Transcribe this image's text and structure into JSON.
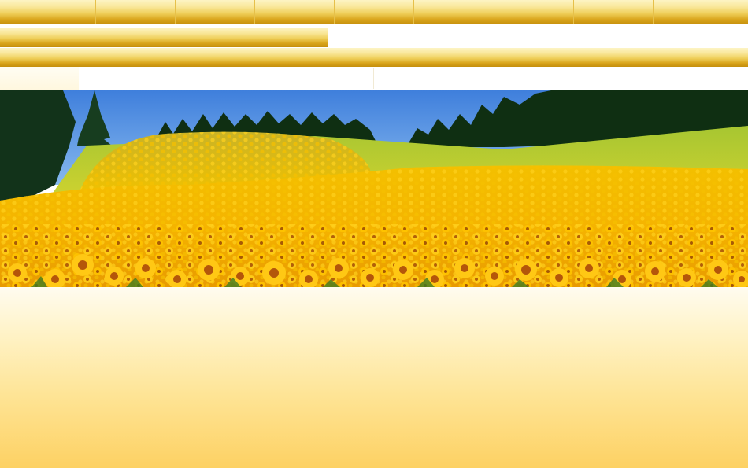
{
  "nav": {
    "tabs": [
      {
        "label": ""
      },
      {
        "label": ""
      },
      {
        "label": ""
      },
      {
        "label": ""
      },
      {
        "label": ""
      },
      {
        "label": ""
      },
      {
        "label": ""
      },
      {
        "label": ""
      },
      {
        "label": ""
      }
    ]
  },
  "hero": {
    "image": "sunflower-field",
    "description_alt": ""
  },
  "colors": {
    "gold_light": "#fdf4c4",
    "gold_mid": "#efcf5a",
    "gold_dark": "#c58f0c",
    "sky": "#4f8ee0",
    "sunflower": "#f5b400",
    "content_bg_bottom": "#fdd163"
  }
}
